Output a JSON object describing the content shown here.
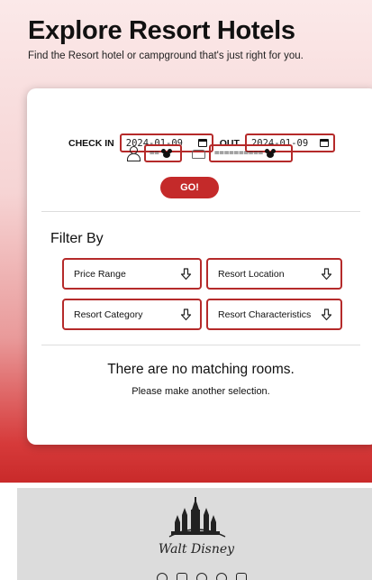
{
  "header": {
    "title": "Explore Resort Hotels",
    "subtitle": "Find the Resort hotel or campground that's just right for you."
  },
  "search": {
    "check_in_label": "CHECK IN",
    "check_in_value": "2024-01-09",
    "check_out_label": "OUT",
    "check_out_value": "2024-01-09",
    "guests_value": "==",
    "room_value": "==========",
    "go_label": "GO!"
  },
  "filters": {
    "title": "Filter By",
    "items": [
      {
        "label": "Price Range"
      },
      {
        "label": "Resort Location"
      },
      {
        "label": "Resort Category"
      },
      {
        "label": "Resort Characteristics"
      }
    ]
  },
  "results": {
    "empty_title": "There are no matching rooms.",
    "empty_subtitle": "Please make another selection."
  },
  "footer": {
    "logo_text": "Walt Disney",
    "social_icons": [
      "facebook-icon",
      "instagram-icon",
      "twitter-icon",
      "pinterest-icon",
      "youtube-icon"
    ]
  },
  "colors": {
    "accent": "#c42a2a",
    "hero_top": "#fbe9e9",
    "hero_bottom": "#c92a2a",
    "footer_bg": "#dcdcdc"
  }
}
